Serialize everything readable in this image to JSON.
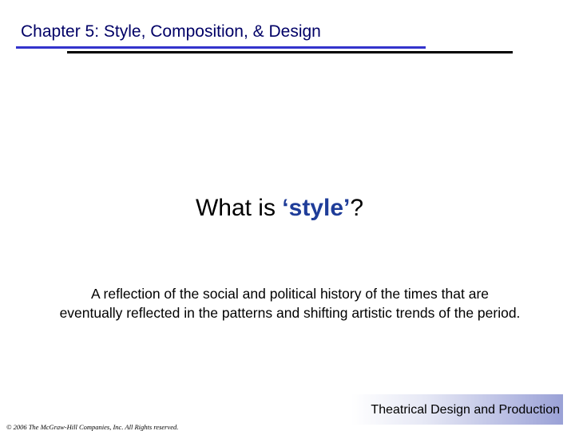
{
  "header": {
    "chapter_title": "Chapter 5:  Style, Composition, & Design"
  },
  "main": {
    "question_prefix": "What is ",
    "question_emphasis": "‘style’",
    "question_suffix": "?",
    "definition_line1": "A reflection of the social and political history of the times that are",
    "definition_line2": "eventually reflected in the patterns and shifting artistic trends of the period."
  },
  "footer": {
    "book_title": "Theatrical Design and Production",
    "copyright": "© 2006 The McGraw-Hill Companies, Inc. All Rights reserved."
  },
  "colors": {
    "title_text": "#000066",
    "rule_blue": "#3333cc",
    "rule_black": "#000000",
    "emphasis": "#1f3d99",
    "footer_gradient_end": "#9aa1d6"
  }
}
